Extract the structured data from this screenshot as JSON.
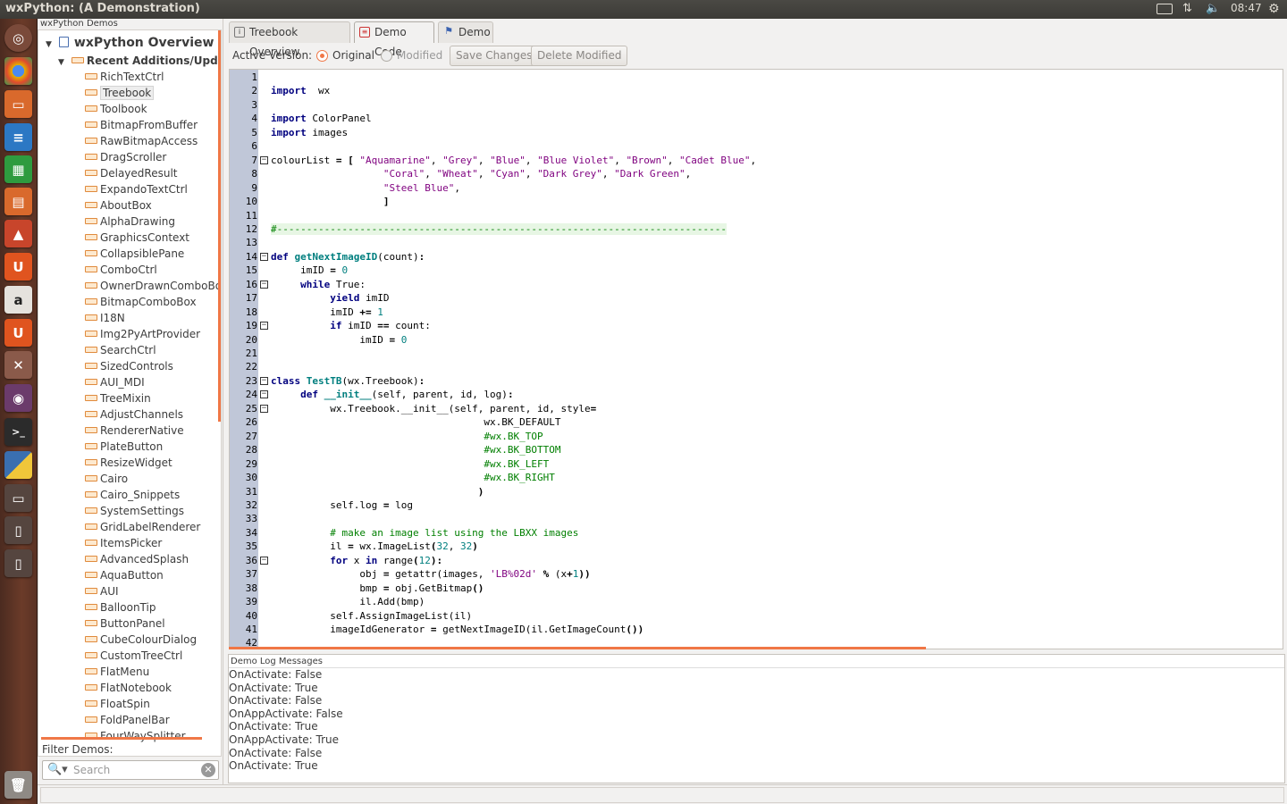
{
  "window": {
    "title": "wxPython: (A Demonstration)"
  },
  "indicators": {
    "time": "08:47"
  },
  "launcher": {
    "icons": [
      "ubuntu-dash-icon",
      "chromium-icon",
      "files-icon",
      "writer-icon",
      "calc-icon",
      "impress-icon",
      "software-center-icon",
      "ubuntu-one-icon",
      "amazon-icon",
      "ubuntu-one-music-icon",
      "settings-icon",
      "eye-icon",
      "terminal-icon",
      "python-icon",
      "window-icon",
      "device-icon",
      "device2-icon",
      "trash-icon"
    ]
  },
  "tree": {
    "header": "wxPython Demos",
    "root": "wxPython Overview",
    "section": "Recent Additions/Updat",
    "items": [
      "RichTextCtrl",
      "Treebook",
      "Toolbook",
      "BitmapFromBuffer",
      "RawBitmapAccess",
      "DragScroller",
      "DelayedResult",
      "ExpandoTextCtrl",
      "AboutBox",
      "AlphaDrawing",
      "GraphicsContext",
      "CollapsiblePane",
      "ComboCtrl",
      "OwnerDrawnComboBo",
      "BitmapComboBox",
      "I18N",
      "Img2PyArtProvider",
      "SearchCtrl",
      "SizedControls",
      "AUI_MDI",
      "TreeMixin",
      "AdjustChannels",
      "RendererNative",
      "PlateButton",
      "ResizeWidget",
      "Cairo",
      "Cairo_Snippets",
      "SystemSettings",
      "GridLabelRenderer",
      "ItemsPicker",
      "AdvancedSplash",
      "AquaButton",
      "AUI",
      "BalloonTip",
      "ButtonPanel",
      "CubeColourDialog",
      "CustomTreeCtrl",
      "FlatMenu",
      "FlatNotebook",
      "FloatSpin",
      "FoldPanelBar",
      "FourWaySplitter"
    ],
    "selected": "Treebook"
  },
  "filter": {
    "label": "Filter Demos:",
    "placeholder": "Search"
  },
  "tabs": [
    {
      "label": "Treebook Overview"
    },
    {
      "label": "Demo Code"
    },
    {
      "label": "Demo"
    }
  ],
  "version": {
    "label": "Active Version:",
    "original": "Original",
    "modified": "Modified",
    "save": "Save Changes",
    "delete": "Delete Modified"
  },
  "code": {
    "lines": [
      "1",
      "2",
      "3",
      "4",
      "5",
      "6",
      "7",
      "8",
      "9",
      "10",
      "11",
      "12",
      "13",
      "14",
      "15",
      "16",
      "17",
      "18",
      "19",
      "20",
      "21",
      "22",
      "23",
      "24",
      "25",
      "26",
      "27",
      "28",
      "29",
      "30",
      "31",
      "32",
      "33",
      "34",
      "35",
      "36",
      "37",
      "38",
      "39",
      "40",
      "41",
      "42"
    ],
    "l2": [
      "import",
      "  wx"
    ],
    "l4": [
      "import",
      " ColorPanel"
    ],
    "l5": [
      "import",
      " images"
    ],
    "l7": [
      "colourList ",
      "= [ ",
      "\"Aquamarine\"",
      ", ",
      "\"Grey\"",
      ", ",
      "\"Blue\"",
      ", ",
      "\"Blue Violet\"",
      ", ",
      "\"Brown\"",
      ", ",
      "\"Cadet Blue\"",
      ","
    ],
    "l8": [
      "\"Coral\"",
      ", ",
      "\"Wheat\"",
      ", ",
      "\"Cyan\"",
      ", ",
      "\"Dark Grey\"",
      ", ",
      "\"Dark Green\"",
      ","
    ],
    "l9": [
      "\"Steel Blue\"",
      ","
    ],
    "l10": "]",
    "l12": "#----------------------------------------------------------------------------",
    "l14": [
      "def ",
      "getNextImageID",
      "(count)",
      ":"
    ],
    "l15": [
      "imID ",
      "= ",
      "0"
    ],
    "l16": [
      "while",
      " True:"
    ],
    "l17": [
      "yield",
      " imID"
    ],
    "l18": [
      "imID ",
      "+= ",
      "1"
    ],
    "l19": [
      "if",
      " imID ",
      "==",
      " count:"
    ],
    "l20": [
      "imID ",
      "= ",
      "0"
    ],
    "l23": [
      "class ",
      "TestTB",
      "(wx.Treebook)",
      ":"
    ],
    "l24": [
      "def ",
      "__init__",
      "(self, parent, id, log)",
      ":"
    ],
    "l25": [
      "wx.Treebook.__init__",
      "(self, parent, id, style",
      "="
    ],
    "l26": "wx.BK_DEFAULT",
    "l27": "#wx.BK_TOP",
    "l28": "#wx.BK_BOTTOM",
    "l29": "#wx.BK_LEFT",
    "l30": "#wx.BK_RIGHT",
    "l31": ")",
    "l32": [
      "self.log ",
      "= ",
      "log"
    ],
    "l34": "# make an image list using the LBXX images",
    "l35": [
      "il ",
      "= ",
      "wx.ImageList",
      "(",
      "32",
      ", ",
      "32",
      ")"
    ],
    "l36": [
      "for",
      " x ",
      "in",
      " range",
      "(",
      "12",
      ")",
      ":"
    ],
    "l37": [
      "obj ",
      "= ",
      "getattr",
      "(images, ",
      "'LB%02d'",
      " % ",
      "(x",
      "+",
      "1",
      "))"
    ],
    "l38": [
      "bmp ",
      "= ",
      "obj.GetBitmap",
      "()"
    ],
    "l39": [
      "il.Add",
      "(bmp)"
    ],
    "l40": [
      "self.AssignImageList",
      "(il)"
    ],
    "l41": [
      "imageIdGenerator ",
      "= ",
      "getNextImageID",
      "(il.GetImageCount",
      "())"
    ]
  },
  "log": {
    "title": "Demo Log Messages",
    "lines": [
      "OnActivate: False",
      "OnActivate: True",
      "OnActivate: False",
      "OnAppActivate: False",
      "OnActivate: True",
      "OnAppActivate: True",
      "OnActivate: False",
      "OnActivate: True"
    ]
  },
  "colors": {
    "accent": "#f07746",
    "gutter": "#c0c7d8",
    "keyword": "#00007f",
    "string": "#7f007f",
    "comment": "#007f00",
    "number": "#007f7f"
  }
}
